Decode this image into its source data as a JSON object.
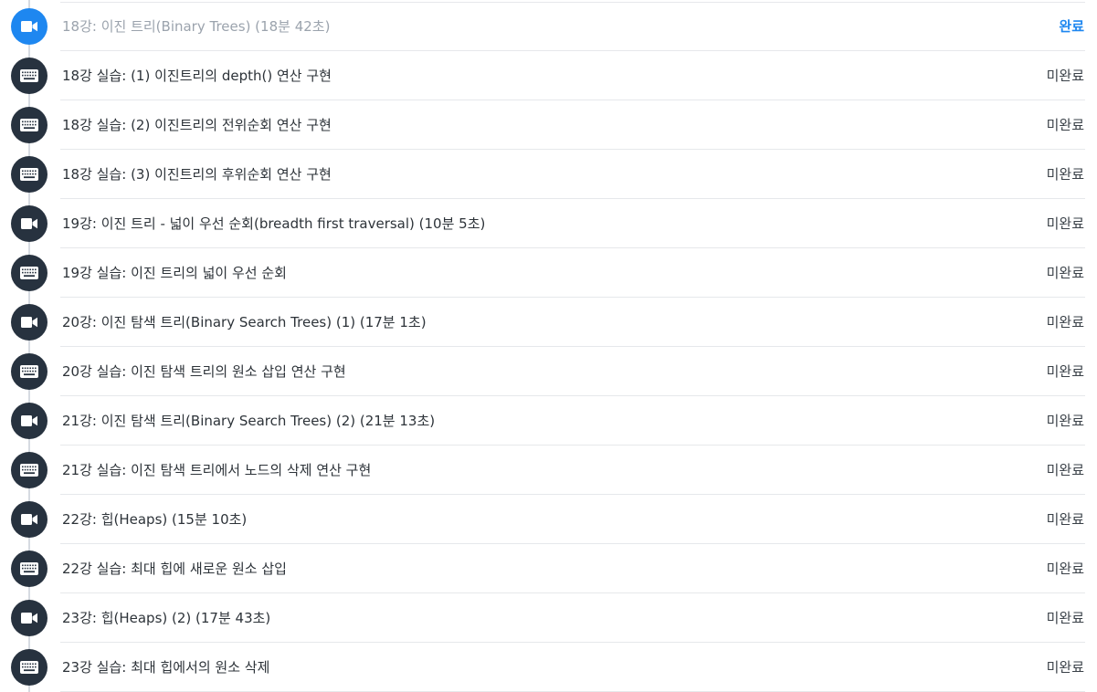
{
  "accent_color": "#1e87f0",
  "icon_bg_color": "#27323f",
  "lessons": [
    {
      "icon": "video-camera-icon",
      "title": "18강: 이진 트리(Binary Trees) (18분 42초)",
      "status": "완료",
      "completed": true
    },
    {
      "icon": "keyboard-icon",
      "title": "18강 실습: (1) 이진트리의 depth() 연산 구현",
      "status": "미완료",
      "completed": false
    },
    {
      "icon": "keyboard-icon",
      "title": "18강 실습: (2) 이진트리의 전위순회 연산 구현",
      "status": "미완료",
      "completed": false
    },
    {
      "icon": "keyboard-icon",
      "title": "18강 실습: (3) 이진트리의 후위순회 연산 구현",
      "status": "미완료",
      "completed": false
    },
    {
      "icon": "video-camera-icon",
      "title": "19강: 이진 트리 - 넓이 우선 순회(breadth first traversal) (10분 5초)",
      "status": "미완료",
      "completed": false
    },
    {
      "icon": "keyboard-icon",
      "title": "19강 실습: 이진 트리의 넓이 우선 순회",
      "status": "미완료",
      "completed": false
    },
    {
      "icon": "video-camera-icon",
      "title": "20강: 이진 탐색 트리(Binary Search Trees) (1) (17분 1초)",
      "status": "미완료",
      "completed": false
    },
    {
      "icon": "keyboard-icon",
      "title": "20강 실습: 이진 탐색 트리의 원소 삽입 연산 구현",
      "status": "미완료",
      "completed": false
    },
    {
      "icon": "video-camera-icon",
      "title": "21강: 이진 탐색 트리(Binary Search Trees) (2) (21분 13초)",
      "status": "미완료",
      "completed": false
    },
    {
      "icon": "keyboard-icon",
      "title": "21강 실습: 이진 탐색 트리에서 노드의 삭제 연산 구현",
      "status": "미완료",
      "completed": false
    },
    {
      "icon": "video-camera-icon",
      "title": "22강: 힙(Heaps) (15분 10초)",
      "status": "미완료",
      "completed": false
    },
    {
      "icon": "keyboard-icon",
      "title": "22강 실습: 최대 힙에 새로운 원소 삽입",
      "status": "미완료",
      "completed": false
    },
    {
      "icon": "video-camera-icon",
      "title": "23강: 힙(Heaps) (2) (17분 43초)",
      "status": "미완료",
      "completed": false
    },
    {
      "icon": "keyboard-icon",
      "title": "23강 실습: 최대 힙에서의 원소 삭제",
      "status": "미완료",
      "completed": false
    }
  ]
}
